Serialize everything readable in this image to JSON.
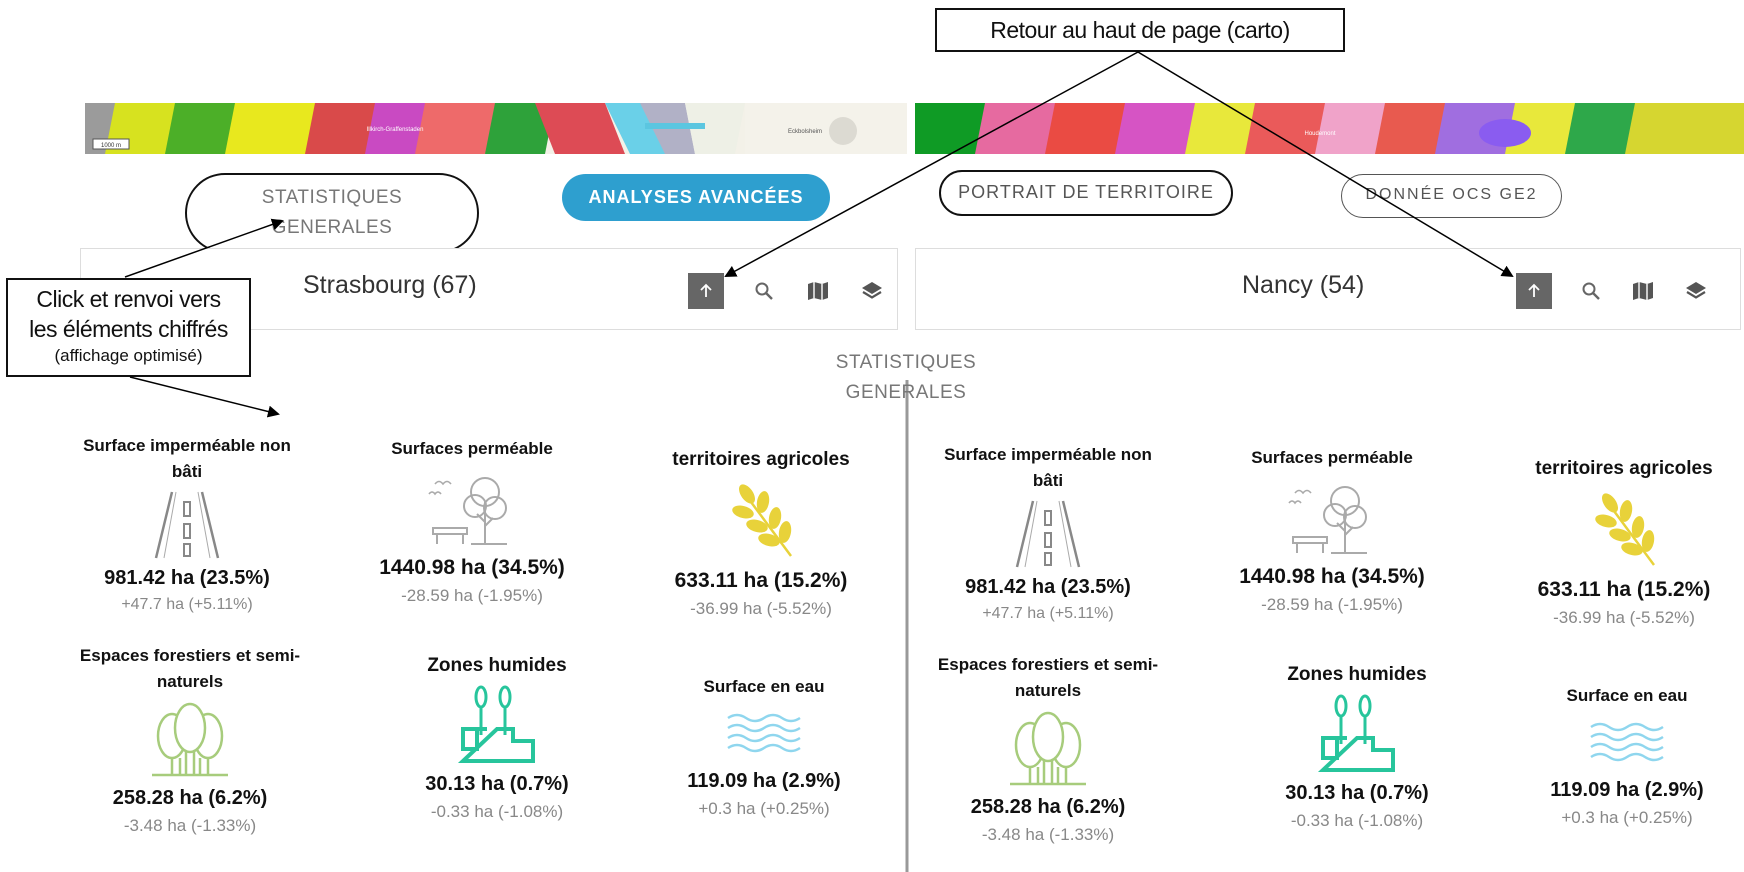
{
  "annotations": {
    "back_to_top": "Retour au haut de page (carto)",
    "click_note_line1": "Click et renvoi vers",
    "click_note_line2": "les éléments chiffrés",
    "click_note_line3": "(affichage optimisé)"
  },
  "tabs": {
    "stats_line1": "STATISTIQUES",
    "stats_line2": "GENERALES",
    "advanced": "ANALYSES AVANCÉES",
    "portrait": "PORTRAIT DE TERRITOIRE",
    "donnee": "DONNÉE OCS GE2"
  },
  "section": {
    "line1": "STATISTIQUES",
    "line2": "GENERALES"
  },
  "territories": [
    {
      "name": "Strasbourg (67)",
      "stats": {
        "impermeable": {
          "title_line1": "Surface imperméable non",
          "title_line2": "bâti",
          "value": "981.42 ha (23.5%)",
          "delta": "+47.7 ha (+5.11%)"
        },
        "permeable": {
          "title": "Surfaces perméable",
          "value": "1440.98 ha (34.5%)",
          "delta": "-28.59 ha (-1.95%)"
        },
        "agricole": {
          "title": "territoires agricoles",
          "value": "633.11 ha (15.2%)",
          "delta": "-36.99 ha (-5.52%)"
        },
        "forest": {
          "title_line1": "Espaces forestiers et semi-",
          "title_line2": "naturels",
          "value": "258.28 ha (6.2%)",
          "delta": "-3.48 ha (-1.33%)"
        },
        "humide": {
          "title": "Zones humides",
          "value": "30.13 ha (0.7%)",
          "delta": "-0.33 ha (-1.08%)"
        },
        "eau": {
          "title": "Surface en eau",
          "value": "119.09 ha (2.9%)",
          "delta": "+0.3 ha (+0.25%)"
        }
      }
    },
    {
      "name": "Nancy (54)",
      "stats": {
        "impermeable": {
          "title_line1": "Surface imperméable non",
          "title_line2": "bâti",
          "value": "981.42 ha (23.5%)",
          "delta": "+47.7 ha (+5.11%)"
        },
        "permeable": {
          "title": "Surfaces perméable",
          "value": "1440.98 ha (34.5%)",
          "delta": "-28.59 ha (-1.95%)"
        },
        "agricole": {
          "title": "territoires agricoles",
          "value": "633.11 ha (15.2%)",
          "delta": "-36.99 ha (-5.52%)"
        },
        "forest": {
          "title_line1": "Espaces forestiers et semi-",
          "title_line2": "naturels",
          "value": "258.28 ha (6.2%)",
          "delta": "-3.48 ha (-1.33%)"
        },
        "humide": {
          "title": "Zones humides",
          "value": "30.13 ha (0.7%)",
          "delta": "-0.33 ha (-1.08%)"
        },
        "eau": {
          "title": "Surface en eau",
          "value": "119.09 ha (2.9%)",
          "delta": "+0.3 ha (+0.25%)"
        }
      }
    }
  ],
  "map_labels": {
    "left_scale": "1000 m",
    "left_place1": "Illkirch-Graffenstaden",
    "left_place2": "Eckbolsheim",
    "right_place1": "Houdemont"
  },
  "icons": {
    "up": "arrow-up-icon",
    "search": "search-icon",
    "map": "map-icon",
    "layers": "layers-icon"
  },
  "colors": {
    "accent": "#2e9fcf",
    "agricole": "#e8d23a",
    "forest": "#a7cc7c",
    "humide": "#27c59c",
    "eau": "#8fd6ee",
    "neutral_icon": "#999999"
  }
}
